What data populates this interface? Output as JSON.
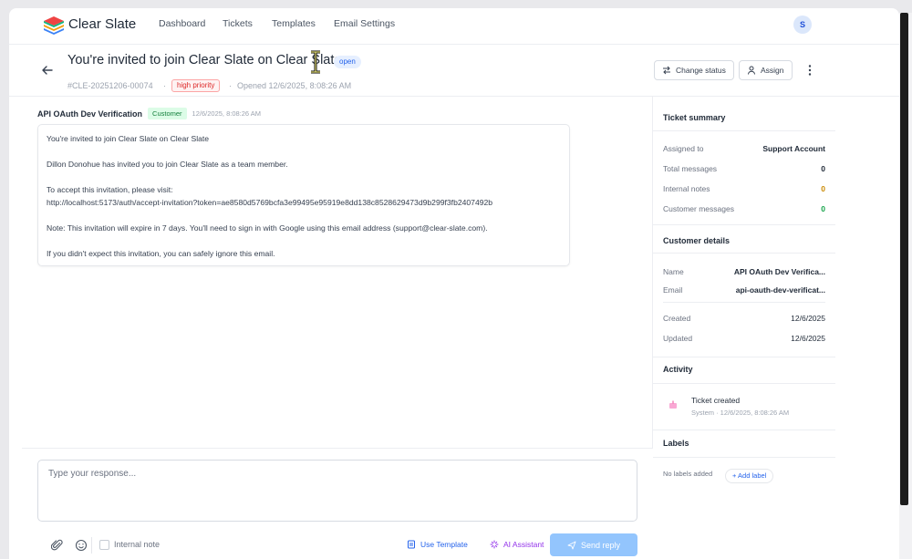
{
  "app": {
    "brand": "Clear Slate",
    "nav": [
      "Dashboard",
      "Tickets",
      "Templates",
      "Email Settings"
    ],
    "avatar_initial": "S"
  },
  "ticket": {
    "title": "You're invited to join Clear Slate on Clear Slate",
    "status": "open",
    "id": "#CLE-20251206-00074",
    "priority": "high priority",
    "opened": "Opened 12/6/2025, 8:08:26 AM",
    "actions": {
      "change_status": "Change status",
      "assign": "Assign"
    }
  },
  "message": {
    "sender": "API OAuth Dev Verification",
    "role": "Customer",
    "time": "12/6/2025, 8:08:26 AM",
    "lines": [
      "You're invited to join Clear Slate on Clear Slate",
      "Dillon Donohue has invited you to join Clear Slate as a team member.",
      "To accept this invitation, please visit:",
      "http://localhost:5173/auth/accept-invitation?token=ae8580d5769bcfa3e99495e95919e8dd138c8528629473d9b299f3fb2407492b",
      "Note: This invitation will expire in 7 days. You'll need to sign in with Google using this email address (support@clear-slate.com).",
      "If you didn't expect this invitation, you can safely ignore this email."
    ]
  },
  "composer": {
    "placeholder": "Type your response...",
    "internal_note": "Internal note",
    "use_template": "Use Template",
    "ai_assistant": "AI Assistant",
    "send": "Send reply"
  },
  "summary": {
    "title": "Ticket summary",
    "assigned_label": "Assigned to",
    "assigned_value": "Support Account",
    "total_label": "Total messages",
    "total_value": "0",
    "internal_label": "Internal notes",
    "internal_value": "0",
    "customer_label": "Customer messages",
    "customer_value": "0"
  },
  "customer": {
    "title": "Customer details",
    "name_label": "Name",
    "name_value": "API OAuth Dev Verifica...",
    "email_label": "Email",
    "email_value": "api-oauth-dev-verificat...",
    "created_label": "Created",
    "created_value": "12/6/2025",
    "updated_label": "Updated",
    "updated_value": "12/6/2025"
  },
  "activity": {
    "title": "Activity",
    "event": "Ticket created",
    "meta": "System · 12/6/2025, 8:08:26 AM"
  },
  "labels": {
    "title": "Labels",
    "empty": "No labels added",
    "add": "+ Add label"
  },
  "colors": {
    "accent": "#2563eb",
    "send_disabled": "#93c5fd",
    "priority": "#dc2626",
    "customer_tag": "#15803d",
    "internal_notes_value": "#ca8a04"
  },
  "icons": [
    "logo-icon",
    "back-arrow-icon",
    "swap-icon",
    "user-icon",
    "more-vertical-icon",
    "activity-icon",
    "paperclip-icon",
    "emoji-icon",
    "template-icon",
    "ai-sparkle-icon",
    "send-icon"
  ]
}
